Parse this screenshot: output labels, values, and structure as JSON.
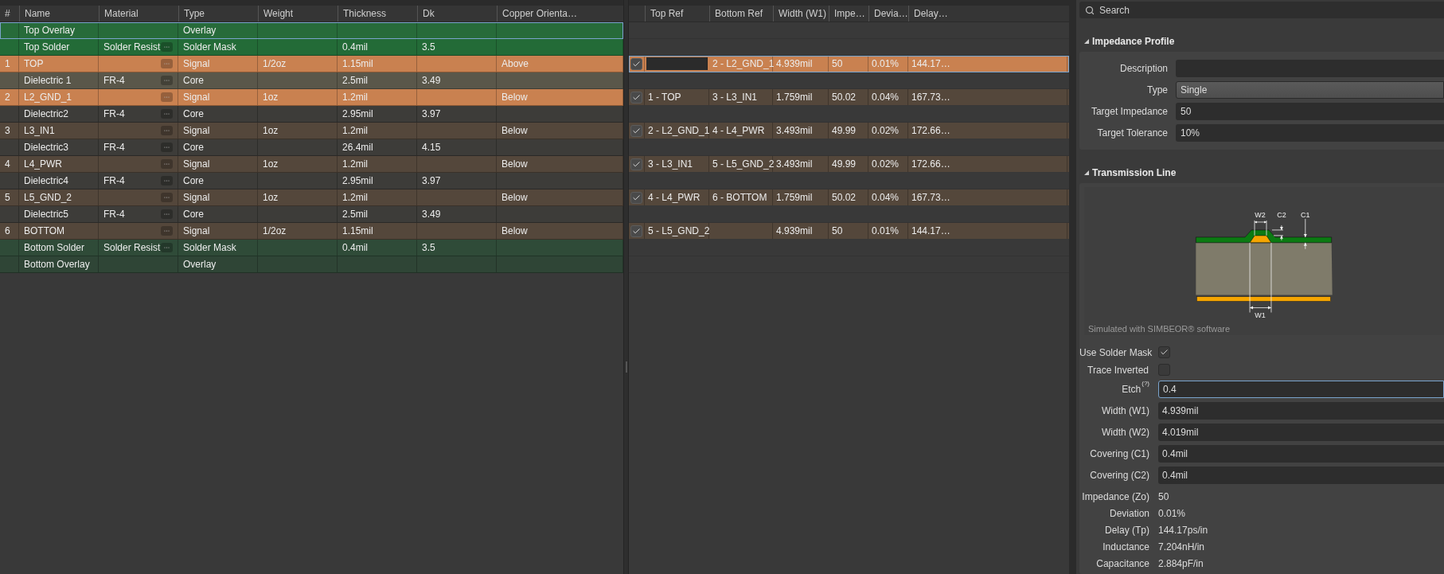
{
  "layer_table": {
    "columns": [
      "#",
      "Name",
      "Material",
      "Type",
      "Weight",
      "Thickness",
      "Dk",
      "Copper Orienta…"
    ],
    "rows": [
      {
        "number": "",
        "name": "Top Overlay",
        "material": "",
        "type": "Overlay",
        "weight": "",
        "thickness": "",
        "dk": "",
        "copper_orientation": "",
        "kind": "overlay",
        "color": "#276b3a",
        "selected": true
      },
      {
        "number": "",
        "name": "Top Solder",
        "material": "Solder Resist",
        "type": "Solder Mask",
        "weight": "",
        "thickness": "0.4mil",
        "dk": "3.5",
        "copper_orientation": "",
        "kind": "solder_mask",
        "color": "#236b37",
        "selected": false
      },
      {
        "number": "1",
        "name": "TOP",
        "material": "",
        "type": "Signal",
        "weight": "1/2oz",
        "thickness": "1.15mil",
        "dk": "",
        "copper_orientation": "Above",
        "kind": "signal",
        "color": "#c98150",
        "selected": false
      },
      {
        "number": "",
        "name": "Dielectric 1",
        "material": "FR-4",
        "type": "Core",
        "weight": "",
        "thickness": "2.5mil",
        "dk": "3.49",
        "copper_orientation": "",
        "kind": "dielectric",
        "color": "#5a574a",
        "selected": false
      },
      {
        "number": "2",
        "name": "L2_GND_1",
        "material": "",
        "type": "Signal",
        "weight": "1oz",
        "thickness": "1.2mil",
        "dk": "",
        "copper_orientation": "Below",
        "kind": "signal",
        "color": "#c98150",
        "selected": false
      },
      {
        "number": "",
        "name": "Dielectric2",
        "material": "FR-4",
        "type": "Core",
        "weight": "",
        "thickness": "2.95mil",
        "dk": "3.97",
        "copper_orientation": "",
        "kind": "dielectric",
        "color": "#3d3c39",
        "selected": false
      },
      {
        "number": "3",
        "name": "L3_IN1",
        "material": "",
        "type": "Signal",
        "weight": "1oz",
        "thickness": "1.2mil",
        "dk": "",
        "copper_orientation": "Below",
        "kind": "signal",
        "color": "#54473b",
        "selected": false
      },
      {
        "number": "",
        "name": "Dielectric3",
        "material": "FR-4",
        "type": "Core",
        "weight": "",
        "thickness": "26.4mil",
        "dk": "4.15",
        "copper_orientation": "",
        "kind": "dielectric",
        "color": "#3d3c39",
        "selected": false
      },
      {
        "number": "4",
        "name": "L4_PWR",
        "material": "",
        "type": "Signal",
        "weight": "1oz",
        "thickness": "1.2mil",
        "dk": "",
        "copper_orientation": "Below",
        "kind": "signal",
        "color": "#54473b",
        "selected": false
      },
      {
        "number": "",
        "name": "Dielectric4",
        "material": "FR-4",
        "type": "Core",
        "weight": "",
        "thickness": "2.95mil",
        "dk": "3.97",
        "copper_orientation": "",
        "kind": "dielectric",
        "color": "#3d3c39",
        "selected": false
      },
      {
        "number": "5",
        "name": "L5_GND_2",
        "material": "",
        "type": "Signal",
        "weight": "1oz",
        "thickness": "1.2mil",
        "dk": "",
        "copper_orientation": "Below",
        "kind": "signal",
        "color": "#54473b",
        "selected": false
      },
      {
        "number": "",
        "name": "Dielectric5",
        "material": "FR-4",
        "type": "Core",
        "weight": "",
        "thickness": "2.5mil",
        "dk": "3.49",
        "copper_orientation": "",
        "kind": "dielectric",
        "color": "#3d3c39",
        "selected": false
      },
      {
        "number": "6",
        "name": "BOTTOM",
        "material": "",
        "type": "Signal",
        "weight": "1/2oz",
        "thickness": "1.15mil",
        "dk": "",
        "copper_orientation": "Below",
        "kind": "signal",
        "color": "#54473b",
        "selected": false
      },
      {
        "number": "",
        "name": "Bottom Solder",
        "material": "Solder Resist",
        "type": "Solder Mask",
        "weight": "",
        "thickness": "0.4mil",
        "dk": "3.5",
        "copper_orientation": "",
        "kind": "solder_mask",
        "color": "#2f4b38",
        "selected": false
      },
      {
        "number": "",
        "name": "Bottom Overlay",
        "material": "",
        "type": "Overlay",
        "weight": "",
        "thickness": "",
        "dk": "",
        "copper_orientation": "",
        "kind": "overlay",
        "color": "#2f4536",
        "selected": false
      }
    ]
  },
  "impedance_table": {
    "columns": [
      "Top Ref",
      "Bottom Ref",
      "Width (W1)",
      "Impe…",
      "Devia…",
      "Delay…"
    ],
    "rows": [
      {
        "enabled": true,
        "top_ref": "",
        "bottom_ref": "2 - L2_GND_1",
        "width_w1": "4.939mil",
        "impedance": "50",
        "deviation": "0.01%",
        "delay": "144.17…",
        "selected": true
      },
      {
        "enabled": true,
        "top_ref": "1 - TOP",
        "bottom_ref": "3 - L3_IN1",
        "width_w1": "1.759mil",
        "impedance": "50.02",
        "deviation": "0.04%",
        "delay": "167.73…",
        "selected": false
      },
      {
        "enabled": true,
        "top_ref": "2 - L2_GND_1",
        "bottom_ref": "4 - L4_PWR",
        "width_w1": "3.493mil",
        "impedance": "49.99",
        "deviation": "0.02%",
        "delay": "172.66…",
        "selected": false
      },
      {
        "enabled": true,
        "top_ref": "3 - L3_IN1",
        "bottom_ref": "5 - L5_GND_2",
        "width_w1": "3.493mil",
        "impedance": "49.99",
        "deviation": "0.02%",
        "delay": "172.66…",
        "selected": false
      },
      {
        "enabled": true,
        "top_ref": "4 - L4_PWR",
        "bottom_ref": "6 - BOTTOM",
        "width_w1": "1.759mil",
        "impedance": "50.02",
        "deviation": "0.04%",
        "delay": "167.73…",
        "selected": false
      },
      {
        "enabled": true,
        "top_ref": "5 - L5_GND_2",
        "bottom_ref": "",
        "width_w1": "4.939mil",
        "impedance": "50",
        "deviation": "0.01%",
        "delay": "144.17…",
        "selected": false
      }
    ]
  },
  "properties": {
    "search": {
      "placeholder": "Search"
    },
    "impedance_profile": {
      "title": "Impedance Profile",
      "fields": [
        {
          "label": "Description",
          "kind": "text"
        },
        {
          "label": "Type",
          "value": "Single",
          "kind": "dropdown"
        },
        {
          "label": "Target Impedance",
          "value": "50",
          "kind": "text"
        },
        {
          "label": "Target Tolerance",
          "value": "10%",
          "kind": "text"
        }
      ]
    },
    "transmission_line": {
      "title": "Transmission Line",
      "diagram_labels": [
        "W2",
        "C2",
        "C1",
        "W1"
      ],
      "credit": "Simulated with SIMBEOR® software",
      "checkboxes": [
        {
          "label": "Use Solder Mask",
          "checked": true
        },
        {
          "label": "Trace Inverted",
          "checked": false
        }
      ],
      "fields": [
        {
          "label": "Etch",
          "help": "(?)",
          "value": "0.4",
          "focused": true
        },
        {
          "label": "Width (W1)",
          "value": "4.939mil",
          "focused": false
        },
        {
          "label": "Width (W2)",
          "value": "4.019mil",
          "focused": false
        },
        {
          "label": "Covering (C1)",
          "value": "0.4mil",
          "focused": false
        },
        {
          "label": "Covering (C2)",
          "value": "0.4mil",
          "focused": false
        }
      ],
      "results": [
        {
          "label": "Impedance (Zo)",
          "value": "50"
        },
        {
          "label": "Deviation",
          "value": "0.01%"
        },
        {
          "label": "Delay (Tp)",
          "value": "144.17ps/in"
        },
        {
          "label": "Inductance",
          "value": "7.204nH/in"
        },
        {
          "label": "Capacitance",
          "value": "2.884pF/in"
        }
      ]
    }
  }
}
